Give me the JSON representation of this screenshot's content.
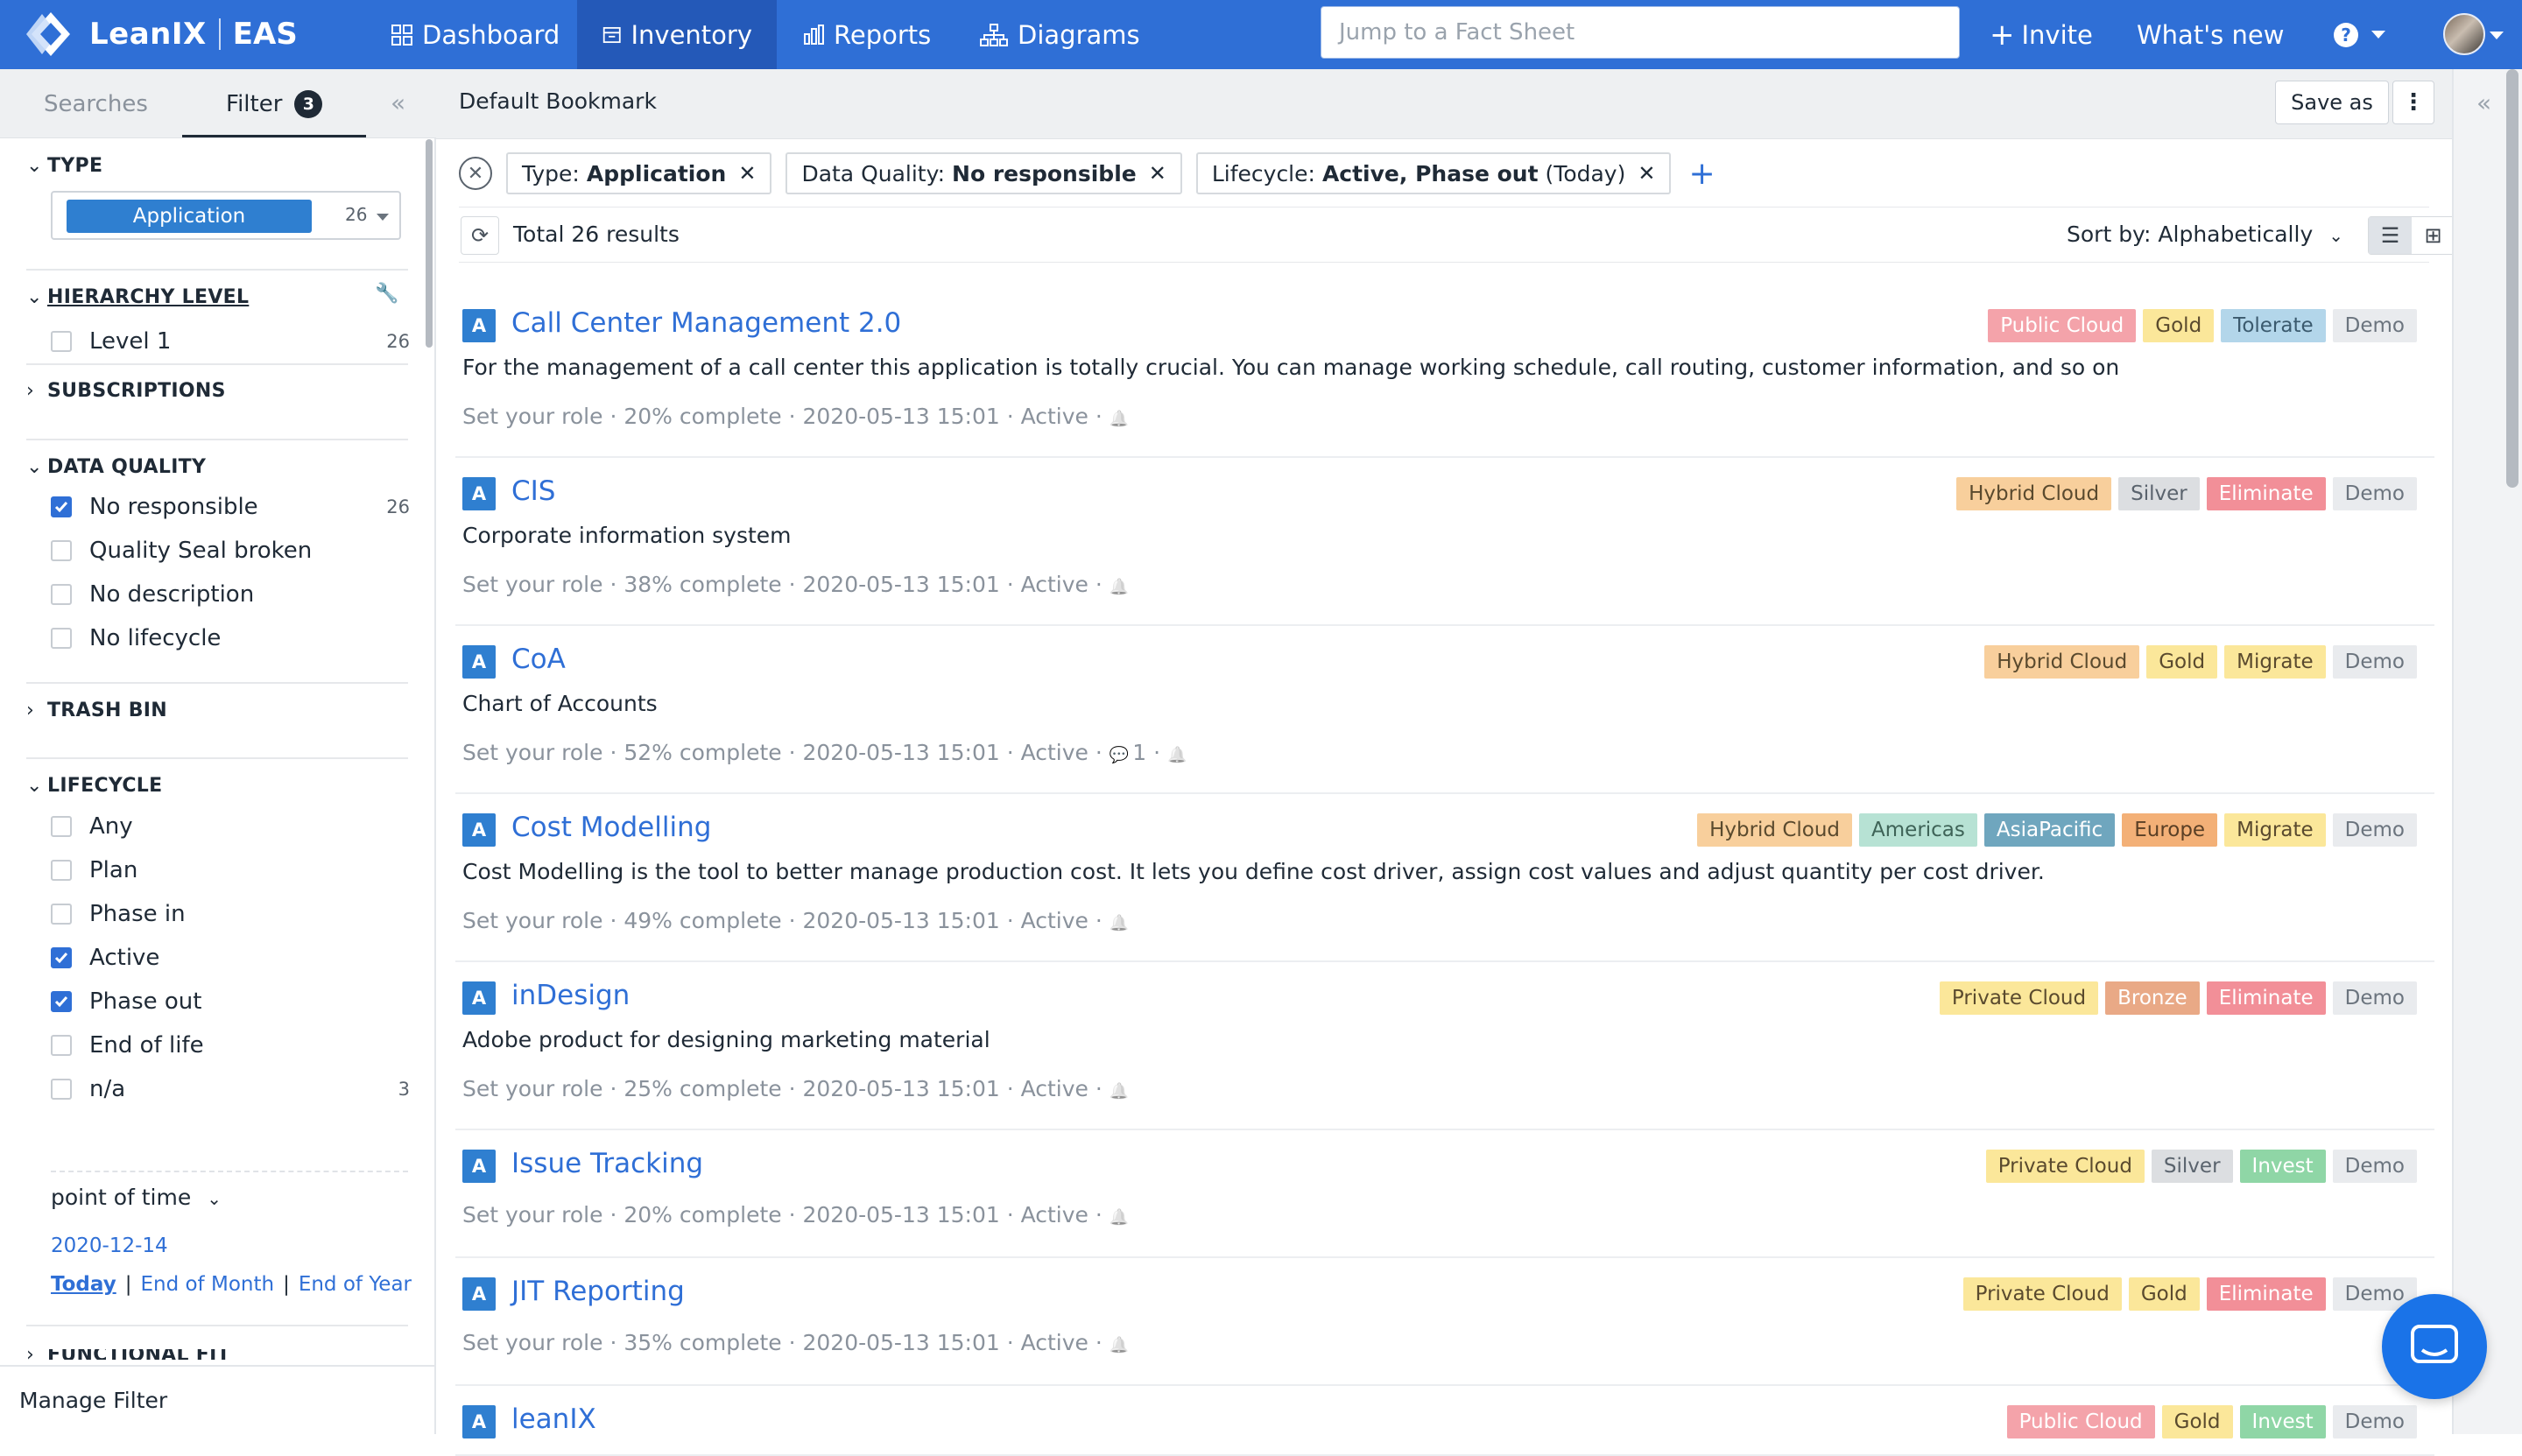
{
  "topnav": {
    "brand": "LeanIX",
    "workspace": "EAS",
    "items": [
      "Dashboard",
      "Inventory",
      "Reports",
      "Diagrams"
    ],
    "search_placeholder": "Jump to a Fact Sheet",
    "invite": "Invite",
    "whats_new": "What's new",
    "help_icon": "question-circle-icon"
  },
  "sidebar": {
    "tabs": {
      "searches": "Searches",
      "filter": "Filter",
      "filter_count": "3"
    },
    "type": {
      "title": "TYPE",
      "selected": "Application",
      "count": "26"
    },
    "hierarchy": {
      "title": "HIERARCHY LEVEL",
      "items": [
        {
          "label": "Level 1",
          "count": "26"
        }
      ]
    },
    "subscriptions": {
      "title": "SUBSCRIPTIONS"
    },
    "data_quality": {
      "title": "DATA QUALITY",
      "items": [
        {
          "label": "No responsible",
          "count": "26"
        },
        {
          "label": "Quality Seal broken",
          "count": ""
        },
        {
          "label": "No description",
          "count": ""
        },
        {
          "label": "No lifecycle",
          "count": ""
        }
      ]
    },
    "trash": {
      "title": "TRASH BIN"
    },
    "lifecycle": {
      "title": "LIFECYCLE",
      "items": [
        {
          "label": "Any",
          "count": ""
        },
        {
          "label": "Plan",
          "count": ""
        },
        {
          "label": "Phase in",
          "count": ""
        },
        {
          "label": "Active",
          "count": ""
        },
        {
          "label": "Phase out",
          "count": ""
        },
        {
          "label": "End of life",
          "count": ""
        },
        {
          "label": "n/a",
          "count": "3"
        }
      ],
      "point_of_time": "point of time",
      "date": "2020-12-14",
      "today": "Today",
      "end_of_month": "End of Month",
      "end_of_year": "End of Year"
    },
    "functional_fit": {
      "title": "FUNCTIONAL FIT"
    },
    "manage": "Manage Filter"
  },
  "main": {
    "bookmark": "Default Bookmark",
    "save_as": "Save as",
    "chips": [
      {
        "key": "Type:",
        "value": "Application"
      },
      {
        "key": "Data Quality:",
        "value": "No responsible"
      },
      {
        "key": "Lifecycle:",
        "value": "Active, Phase out",
        "suffix": "(Today)"
      }
    ],
    "total": "Total 26 results",
    "sort": "Sort by: Alphabetically",
    "cards": [
      {
        "name": "Call Center Management 2.0",
        "desc": "For the management of a call center this application is totally crucial. You can manage working schedule, call routing, customer information, and so on",
        "meta": "Set your role · 20% complete · 2020-05-13 15:01 · Active ·",
        "comments": "",
        "tags": [
          "Public Cloud",
          "Gold",
          "Tolerate",
          "Demo"
        ]
      },
      {
        "name": "CIS",
        "desc": "Corporate information system",
        "meta": "Set your role · 38% complete · 2020-05-13 15:01 · Active ·",
        "comments": "",
        "tags": [
          "Hybrid Cloud",
          "Silver",
          "Eliminate",
          "Demo"
        ]
      },
      {
        "name": "CoA",
        "desc": "Chart of Accounts",
        "meta": "Set your role · 52% complete · 2020-05-13 15:01 · Active ·",
        "comments": "1",
        "tags": [
          "Hybrid Cloud",
          "Gold",
          "Migrate",
          "Demo"
        ]
      },
      {
        "name": "Cost Modelling",
        "desc": "Cost Modelling is the tool to better manage production cost. It lets you define cost driver, assign cost values and adjust quantity per cost driver.",
        "meta": "Set your role · 49% complete · 2020-05-13 15:01 · Active ·",
        "comments": "",
        "tags": [
          "Hybrid Cloud",
          "Americas",
          "AsiaPacific",
          "Europe",
          "Migrate",
          "Demo"
        ]
      },
      {
        "name": "inDesign",
        "desc": "Adobe product for designing marketing material",
        "meta": "Set your role · 25% complete · 2020-05-13 15:01 · Active ·",
        "comments": "",
        "tags": [
          "Private Cloud",
          "Bronze",
          "Eliminate",
          "Demo"
        ]
      },
      {
        "name": "Issue Tracking",
        "desc": "",
        "meta": "Set your role · 20% complete · 2020-05-13 15:01 · Active ·",
        "comments": "",
        "tags": [
          "Private Cloud",
          "Silver",
          "Invest",
          "Demo"
        ]
      },
      {
        "name": "JIT Reporting",
        "desc": "",
        "meta": "Set your role · 35% complete · 2020-05-13 15:01 · Active ·",
        "comments": "",
        "tags": [
          "Private Cloud",
          "Gold",
          "Eliminate",
          "Demo"
        ]
      },
      {
        "name": "leanIX",
        "desc": "",
        "meta": "",
        "comments": "",
        "tags": [
          "Public Cloud",
          "Gold",
          "Invest",
          "Demo"
        ]
      }
    ]
  },
  "colors": {
    "nav": "#2f6fd6",
    "link": "#2f6fd6",
    "type_application": "#2f7fd0",
    "tags": {
      "Public Cloud": [
        "#f4a3aa",
        "#ffffff"
      ],
      "Hybrid Cloud": [
        "#f8cf9c",
        "#5a4a2e"
      ],
      "Private Cloud": [
        "#fbe79a",
        "#5a4a2e"
      ],
      "Gold": [
        "#fbe79a",
        "#5a4a2e"
      ],
      "Silver": [
        "#dcdee1",
        "#5a636d"
      ],
      "Bronze": [
        "#e9a986",
        "#ffffff"
      ],
      "Tolerate": [
        "#b3d6ea",
        "#3b5a6e"
      ],
      "Eliminate": [
        "#f28f98",
        "#ffffff"
      ],
      "Migrate": [
        "#fbe79a",
        "#5a4a2e"
      ],
      "Invest": [
        "#8fd6a6",
        "#ffffff"
      ],
      "Demo": [
        "#e9ebee",
        "#6b747e"
      ],
      "Americas": [
        "#b7e2d4",
        "#3e6357"
      ],
      "AsiaPacific": [
        "#6fa6be",
        "#ffffff"
      ],
      "Europe": [
        "#f3b077",
        "#5a3f25"
      ]
    }
  }
}
